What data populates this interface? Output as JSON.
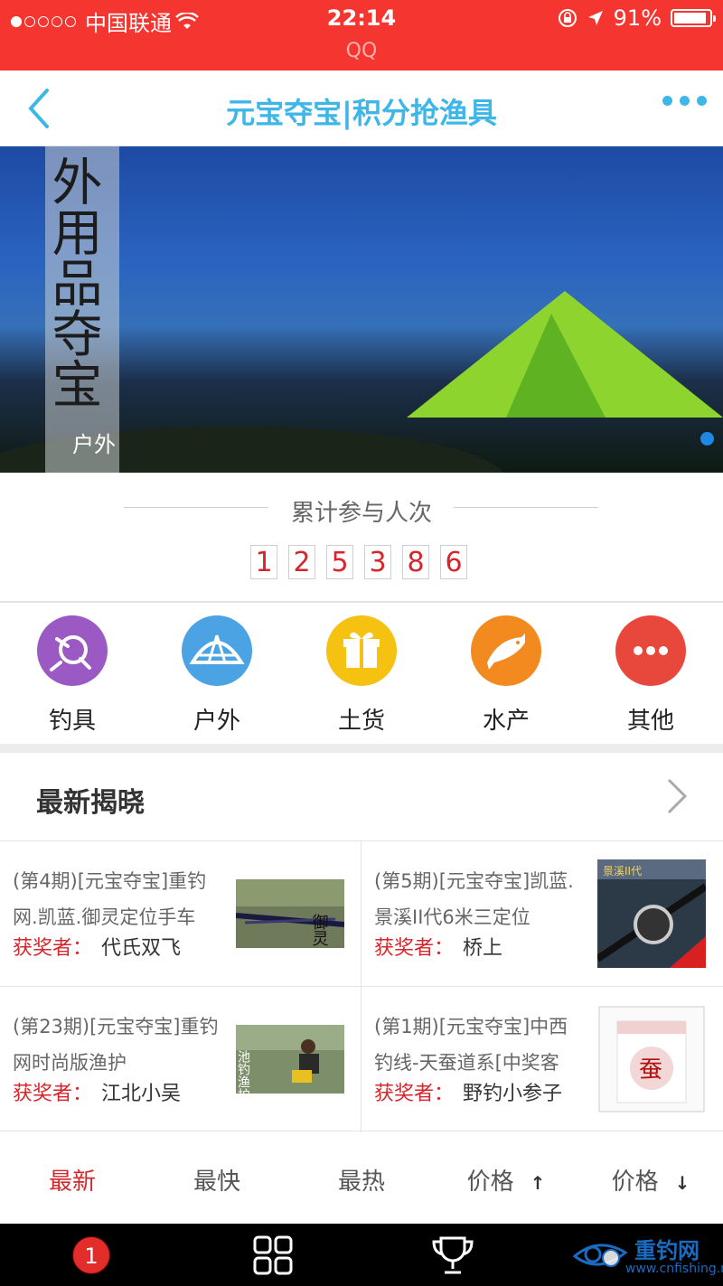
{
  "status_bar": {
    "carrier": "中国联通",
    "time": "22:14",
    "battery": "91%",
    "app_name": "QQ"
  },
  "nav": {
    "title": "元宝夺宝|积分抢渔具"
  },
  "banner": {
    "art_text": "外用品夺宝",
    "label": "户外"
  },
  "counter": {
    "title": "累计参与人次",
    "digits": [
      "1",
      "2",
      "5",
      "3",
      "8",
      "6"
    ]
  },
  "categories": [
    {
      "label": "钓具",
      "icon": "fishing-reel-icon",
      "color": "#9b59c4"
    },
    {
      "label": "户外",
      "icon": "tent-icon",
      "color": "#4ba3e3"
    },
    {
      "label": "土货",
      "icon": "gift-icon",
      "color": "#f5c211"
    },
    {
      "label": "水产",
      "icon": "fish-icon",
      "color": "#f28a20"
    },
    {
      "label": "其他",
      "icon": "more-icon",
      "color": "#e8473c"
    }
  ],
  "latest": {
    "title": "最新揭晓",
    "winner_label": "获奖者：",
    "items": [
      {
        "title": "(第4期)[元宝夺宝]重钓网.凯蓝.御灵定位手车",
        "winner": "代氏双飞",
        "thumb_text": "御灵"
      },
      {
        "title": "(第5期)[元宝夺宝]凯蓝.景溪II代6米三定位",
        "winner": "桥上",
        "thumb_text": "景溪II代"
      },
      {
        "title": "(第23期)[元宝夺宝]重钓网时尚版渔护",
        "winner": "江北小吴",
        "thumb_text": "池钓渔护"
      },
      {
        "title": "(第1期)[元宝夺宝]中西钓线-天蚕道系[中奖客",
        "winner": "野钓小参子",
        "thumb_text": "蚕"
      }
    ]
  },
  "sort_tabs": [
    {
      "label": "最新",
      "arrow": ""
    },
    {
      "label": "最快",
      "arrow": ""
    },
    {
      "label": "最热",
      "arrow": ""
    },
    {
      "label": "价格",
      "arrow": "↑"
    },
    {
      "label": "价格",
      "arrow": "↓"
    }
  ],
  "tab_bar": {
    "badge": "1",
    "watermark_main": "重钓网",
    "watermark_sub": "www.cnfishing.net"
  },
  "colors": {
    "status_red": "#f5352f",
    "accent_blue": "#3eb6e8",
    "active_red": "#d6262b"
  }
}
